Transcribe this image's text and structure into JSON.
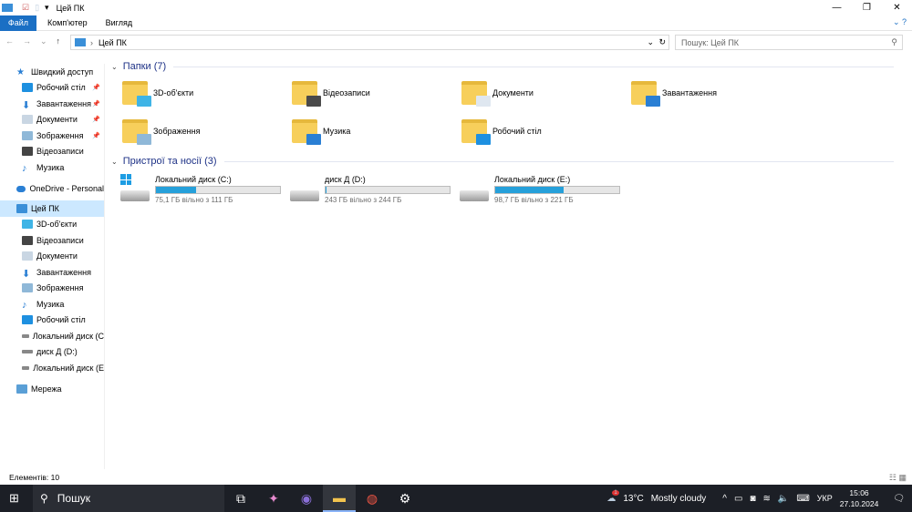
{
  "window": {
    "title": "Цей ПК"
  },
  "ribbon": {
    "tabs": [
      "Файл",
      "Комп'ютер",
      "Вигляд"
    ]
  },
  "address": {
    "path": "Цей ПК",
    "search_placeholder": "Пошук: Цей ПК"
  },
  "sidebar": {
    "quick_access": "Швидкий доступ",
    "quick_items": [
      "Робочий стіл",
      "Завантаження",
      "Документи",
      "Зображення",
      "Відеозаписи",
      "Музика"
    ],
    "onedrive": "OneDrive - Personal",
    "this_pc": "Цей ПК",
    "pc_items": [
      "3D-об'єкти",
      "Відеозаписи",
      "Документи",
      "Завантаження",
      "Зображення",
      "Музика",
      "Робочий стіл",
      "Локальний диск (C",
      "диск Д (D:)",
      "Локальний диск (E"
    ],
    "network": "Мережа"
  },
  "folders": {
    "header": "Папки (7)",
    "items": [
      {
        "name": "3D-об'єкти",
        "color": "#3fb4e6"
      },
      {
        "name": "Відеозаписи",
        "color": "#4a4a4a"
      },
      {
        "name": "Документи",
        "color": "#dfe7f0"
      },
      {
        "name": "Завантаження",
        "color": "#2a7fd4"
      },
      {
        "name": "Зображення",
        "color": "#8fb8d8"
      },
      {
        "name": "Музика",
        "color": "#2a7fd4"
      },
      {
        "name": "Робочий стіл",
        "color": "#1e90e0"
      }
    ]
  },
  "devices": {
    "header": "Пристрої та носії (3)",
    "items": [
      {
        "name": "Локальний диск (C:)",
        "free": "75,1 ГБ вільно з 111 ГБ",
        "used_fraction": 0.32,
        "system": true
      },
      {
        "name": "диск Д (D:)",
        "free": "243 ГБ вільно з 244 ГБ",
        "used_fraction": 0.004,
        "system": false
      },
      {
        "name": "Локальний диск (E:)",
        "free": "98,7 ГБ вільно з 221 ГБ",
        "used_fraction": 0.55,
        "system": false
      }
    ]
  },
  "status": {
    "items": "Елементів: 10"
  },
  "taskbar": {
    "search": "Пошук",
    "weather_temp": "13°C",
    "weather_text": "Mostly cloudy",
    "notification_count": "1",
    "lang": "УКР",
    "time": "15:06",
    "date": "27.10.2024"
  }
}
